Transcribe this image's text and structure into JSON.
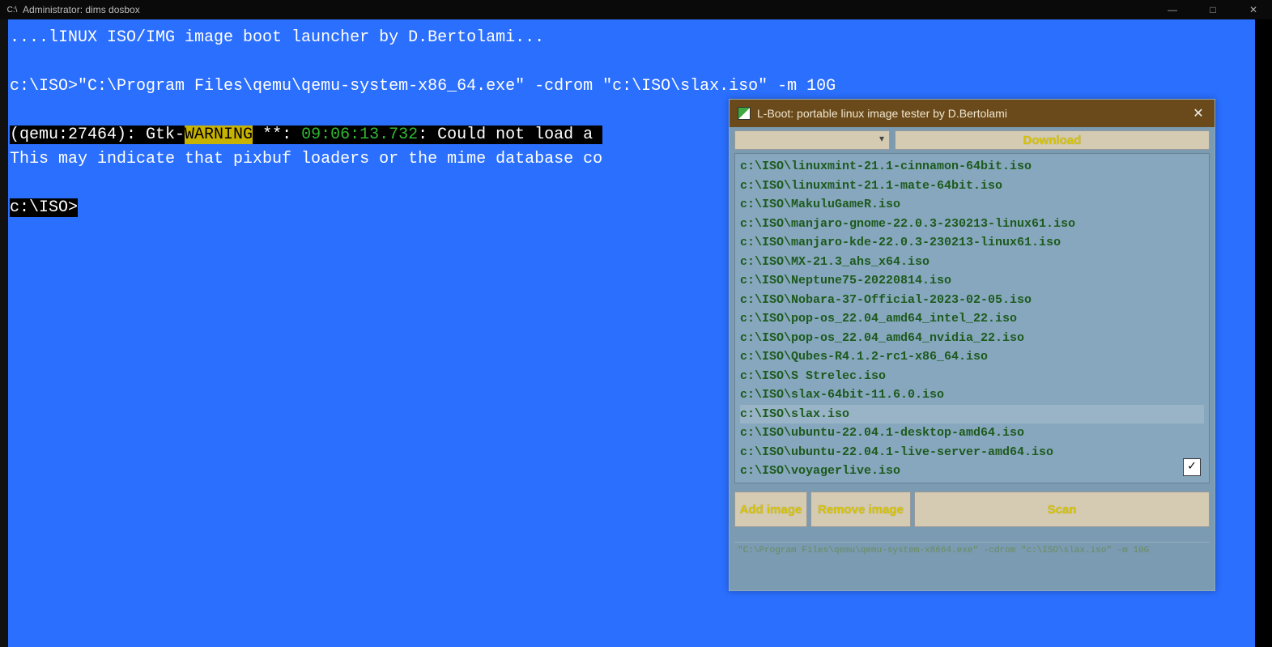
{
  "titlebar": {
    "icon_label": "C:\\",
    "title": "Administrator:  dims dosbox"
  },
  "terminal": {
    "line1": "....lINUX ISO/IMG image boot launcher by D.Bertolami...",
    "prompt1": "c:\\ISO>",
    "cmd1": "\"C:\\Program Files\\qemu\\qemu-system-x86_64.exe\" -cdrom \"c:\\ISO\\slax.iso\" -m 10G",
    "warn_pre": "(qemu:27464): Gtk-",
    "warn_tag": "WARNING",
    "warn_mid": " **: ",
    "warn_ts": "09:06:13.732",
    "warn_post": ": Could not load a ",
    "line_indicate": "This may indicate that pixbuf loaders or the mime database co",
    "prompt2": "c:\\ISO>"
  },
  "lboot": {
    "title": "L-Boot: portable linux image tester by D.Bertolami",
    "download_label": "Download",
    "items": [
      "c:\\ISO\\linuxmint-21.1-cinnamon-64bit.iso",
      "c:\\ISO\\linuxmint-21.1-mate-64bit.iso",
      "c:\\ISO\\MakuluGameR.iso",
      "c:\\ISO\\manjaro-gnome-22.0.3-230213-linux61.iso",
      "c:\\ISO\\manjaro-kde-22.0.3-230213-linux61.iso",
      "c:\\ISO\\MX-21.3_ahs_x64.iso",
      "c:\\ISO\\Neptune75-20220814.iso",
      "c:\\ISO\\Nobara-37-Official-2023-02-05.iso",
      "c:\\ISO\\pop-os_22.04_amd64_intel_22.iso",
      "c:\\ISO\\pop-os_22.04_amd64_nvidia_22.iso",
      "c:\\ISO\\Qubes-R4.1.2-rc1-x86_64.iso",
      "c:\\ISO\\S Strelec.iso",
      "c:\\ISO\\slax-64bit-11.6.0.iso",
      "c:\\ISO\\slax.iso",
      "c:\\ISO\\ubuntu-22.04.1-desktop-amd64.iso",
      "c:\\ISO\\ubuntu-22.04.1-live-server-amd64.iso",
      "c:\\ISO\\voyagerlive.iso"
    ],
    "selected_index": 13,
    "checkbox_checked": true,
    "add_label": "Add image",
    "remove_label": "Remove image",
    "scan_label": "Scan",
    "status": "\"C:\\Program Files\\qemu\\qemu-system-x8664.exe\" -cdrom \"c:\\ISO\\slax.iso\" -m 10G"
  }
}
